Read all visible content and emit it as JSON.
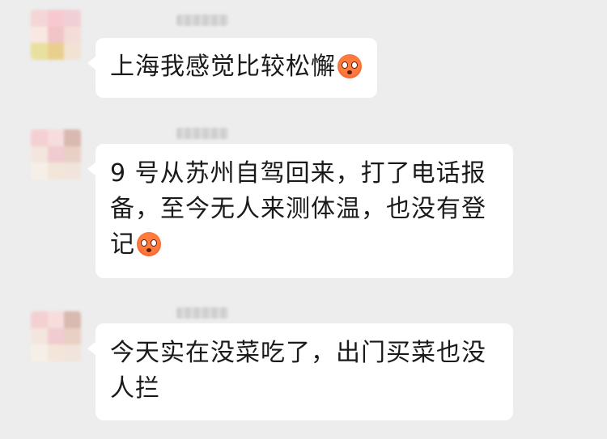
{
  "messages": [
    {
      "sender_name": "",
      "lines": [
        "上海我感觉比较松懈"
      ],
      "emoji": "flushed-face-icon",
      "avatar_colors": [
        "#f4d6d6",
        "#f7c9cf",
        "#f0d0d6",
        "#f9e7e2",
        "#f1c4c8",
        "#f4dcd8",
        "#e9e0a0",
        "#e9cf8e",
        "#f1e3d4"
      ]
    },
    {
      "sender_name": "",
      "lines": [
        "9 号从苏州自驾回来，打了电话报",
        "备，至今无人来测体温，也没有登",
        "记"
      ],
      "emoji": "flushed-face-icon",
      "avatar_colors": [
        "#f4d0d3",
        "#f7dcdc",
        "#d9b9b0",
        "#f3e6df",
        "#f0cbcf",
        "#e8d0c4",
        "#f6efe7",
        "#f4e5d9",
        "#f0e4dc"
      ]
    },
    {
      "sender_name": "",
      "lines": [
        "今天实在没菜吃了，出门买菜也没",
        "人拦"
      ],
      "emoji": "",
      "avatar_colors": [
        "#f4d0d3",
        "#f7dcdc",
        "#d9b9b0",
        "#f3e6df",
        "#f0cbcf",
        "#e8d0c4",
        "#f6efe7",
        "#f4e5d9",
        "#f0e4dc"
      ]
    }
  ],
  "colors": {
    "background": "#ededed",
    "bubble": "#ffffff",
    "text": "#1a1a1a",
    "emoji": "#ff7a3d"
  }
}
